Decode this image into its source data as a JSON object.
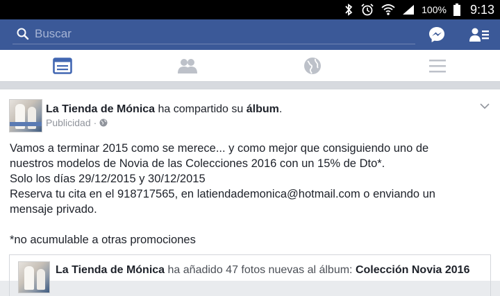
{
  "status_bar": {
    "battery": "100%",
    "time": "9:13"
  },
  "search": {
    "placeholder": "Buscar"
  },
  "tabs": [
    {
      "icon": "news-feed-icon",
      "active": true
    },
    {
      "icon": "friends-icon",
      "active": false
    },
    {
      "icon": "globe-icon",
      "active": false
    },
    {
      "icon": "menu-icon",
      "active": false
    }
  ],
  "post": {
    "page_name": "La Tienda de Mónica",
    "action": "ha compartido su",
    "object": "álbum",
    "object_suffix": ".",
    "sponsored": "Publicidad",
    "meta_dot": "·",
    "lines": [
      "Vamos a terminar 2015 como se merece... y como mejor que consiguiendo uno de",
      "nuestros modelos de Novia de las Colecciones 2016 con un 15% de Dto*.",
      "Solo los días 29/12/2015 y 30/12/2015",
      "Reserva tu cita en el 918717565, en latiendademonica@hotmail.com o enviando un",
      "mensaje privado."
    ],
    "footnote": "*no acumulable a otras promociones",
    "shared": {
      "page_name": "La Tienda de Mónica",
      "action": "ha añadido 47 fotos nuevas al álbum:",
      "album": "Colección Novia 2016"
    }
  },
  "colors": {
    "header": "#3b5998",
    "accent": "#4267b2",
    "tab_inactive": "#bdc1c9"
  }
}
